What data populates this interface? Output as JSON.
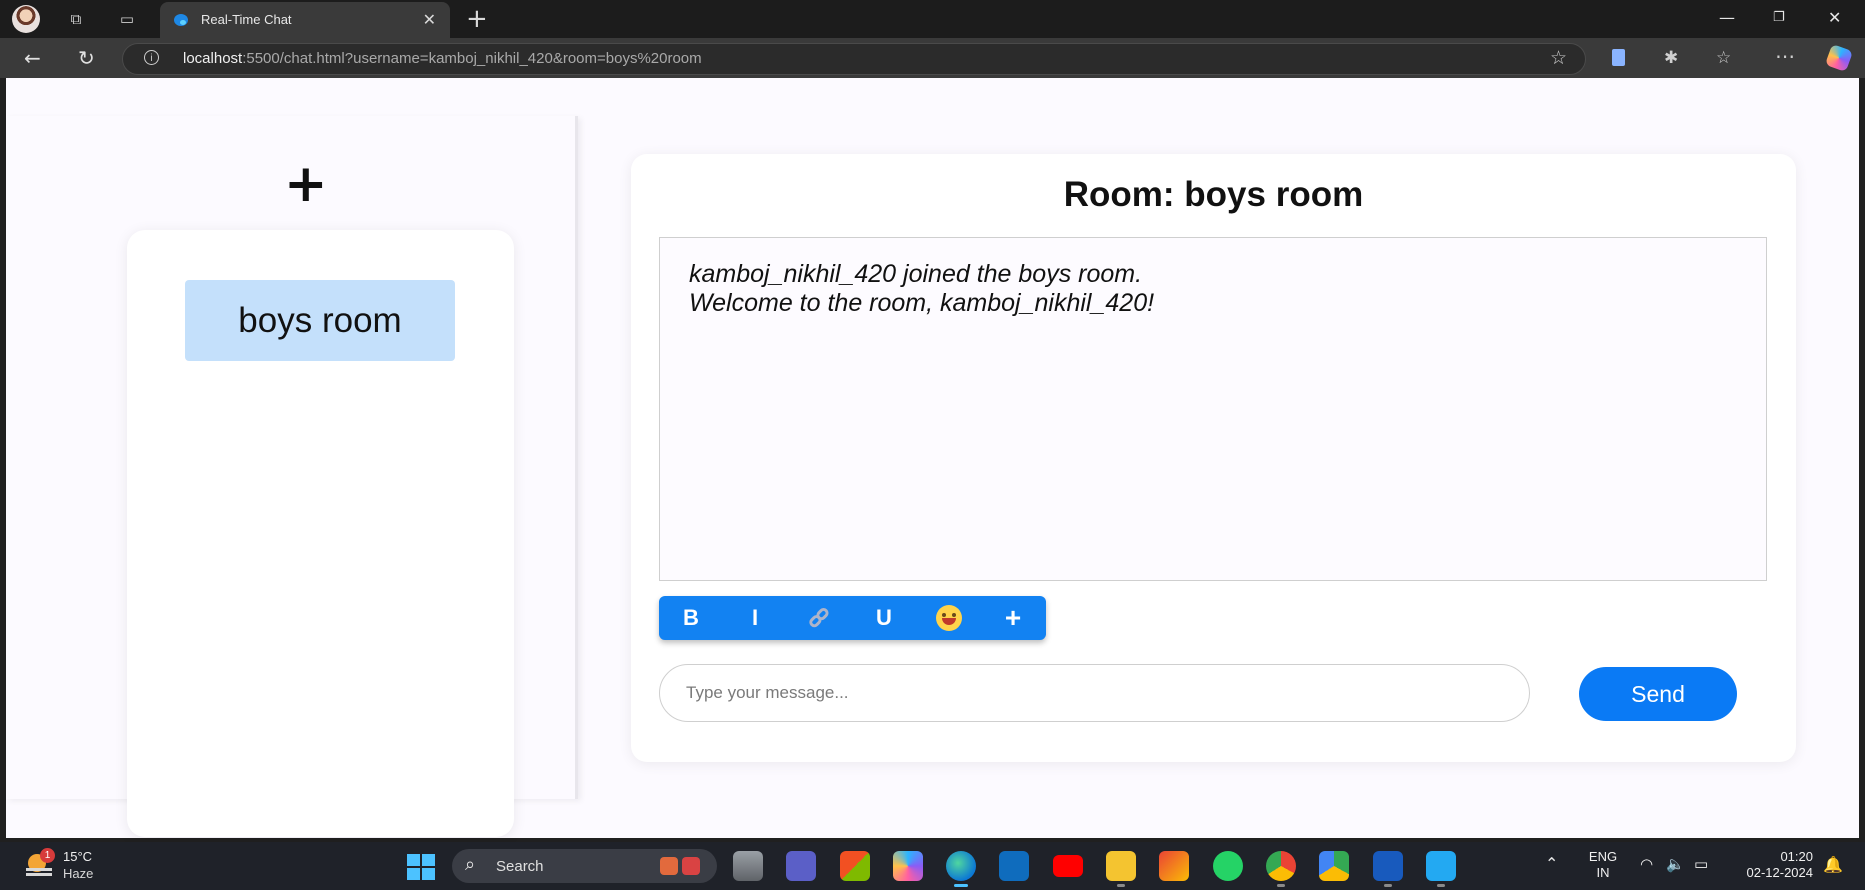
{
  "browser": {
    "tab_title": "Real-Time Chat",
    "url_host": "localhost",
    "url_rest": ":5500/chat.html?username=kamboj_nikhil_420&room=boys%20room"
  },
  "sidebar": {
    "add_room_label": "+",
    "rooms": [
      {
        "label": "boys room",
        "selected": true
      }
    ]
  },
  "chat": {
    "title": "Room: boys room",
    "messages": [
      "kamboj_nikhil_420 joined the boys room.",
      "Welcome to the room, kamboj_nikhil_420!"
    ],
    "toolbar": {
      "bold": "B",
      "italic": "I",
      "underline": "U",
      "more": "+"
    },
    "input_placeholder": "Type your message...",
    "input_value": "",
    "send_label": "Send"
  },
  "taskbar": {
    "weather_temp": "15°C",
    "weather_condition": "Haze",
    "weather_badge": "1",
    "search_label": "Search",
    "lang_line1": "ENG",
    "lang_line2": "IN",
    "time": "01:20",
    "date": "02-12-2024",
    "apps": [
      "task-view",
      "teams",
      "store",
      "copilot",
      "edge",
      "outlook",
      "youtube",
      "file-explorer",
      "gmail",
      "whatsapp",
      "chrome",
      "google-drive",
      "word",
      "vscode"
    ]
  },
  "colors": {
    "accent": "#0a7af5",
    "toolbar": "#1282f2",
    "room_selected": "#c4e0fb",
    "page_bg": "#fcfaff"
  }
}
